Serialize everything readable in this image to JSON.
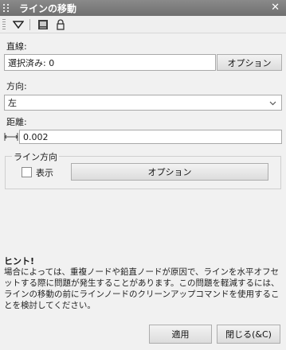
{
  "window": {
    "title": "ラインの移動",
    "close_glyph": "✕"
  },
  "toolbar": {
    "icons": [
      "dropdown-triangle-icon",
      "layers-icon",
      "lock-icon"
    ]
  },
  "straight": {
    "label": "直線:",
    "value": "選択済み: 0",
    "options_button": "オプション"
  },
  "direction": {
    "label": "方向:",
    "selected": "左"
  },
  "distance": {
    "label": "距離:",
    "value": "0.002"
  },
  "line_direction": {
    "group_label": "ライン方向",
    "display_label": "表示",
    "display_checked": false,
    "options_button": "オプション"
  },
  "hint": {
    "title": "ヒント!",
    "text": "場合によっては、重複ノードや鉛直ノードが原因で、ラインを水平オフセットする際に問題が発生することがあります。この問題を軽減するには、ラインの移動の前にラインノードのクリーンアップコマンドを使用することを検討してください。"
  },
  "footer": {
    "apply_button": "適用",
    "close_button": "閉じる(&C)"
  }
}
